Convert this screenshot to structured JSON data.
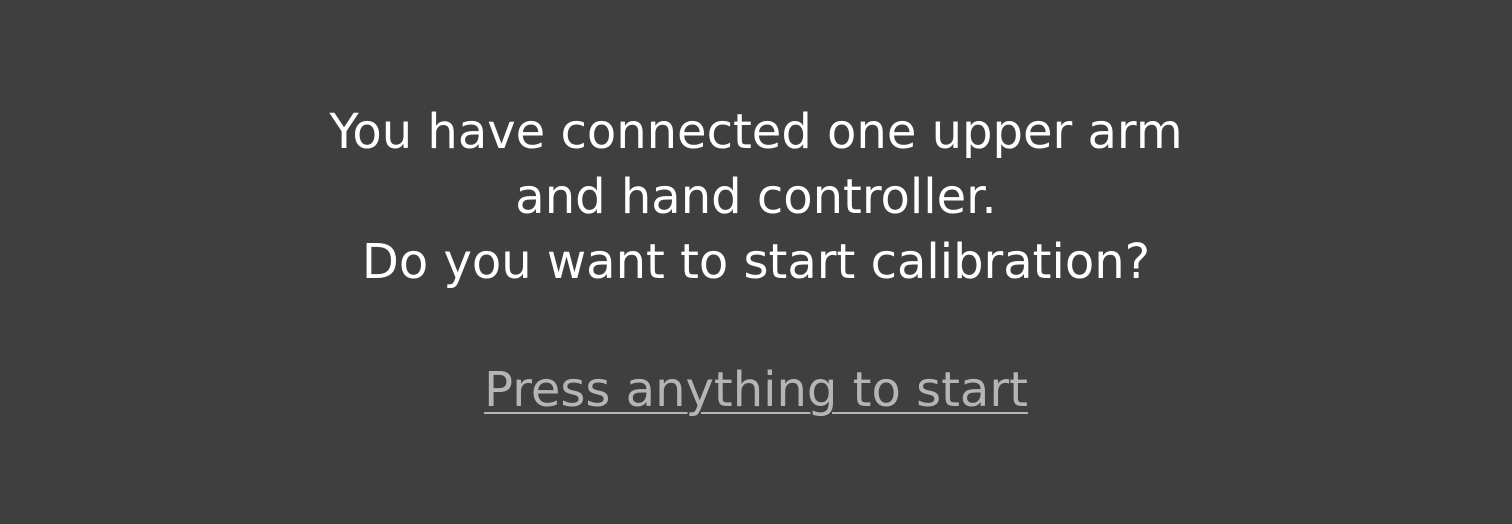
{
  "dialog": {
    "message_lines": [
      "You have connected one upper arm",
      "and hand controller.",
      "Do you want to start calibration?"
    ],
    "start_prompt": "Press anything to start"
  },
  "colors": {
    "background": "#3f3f3f",
    "text": "#ffffff",
    "link": "#b5b5b5"
  }
}
